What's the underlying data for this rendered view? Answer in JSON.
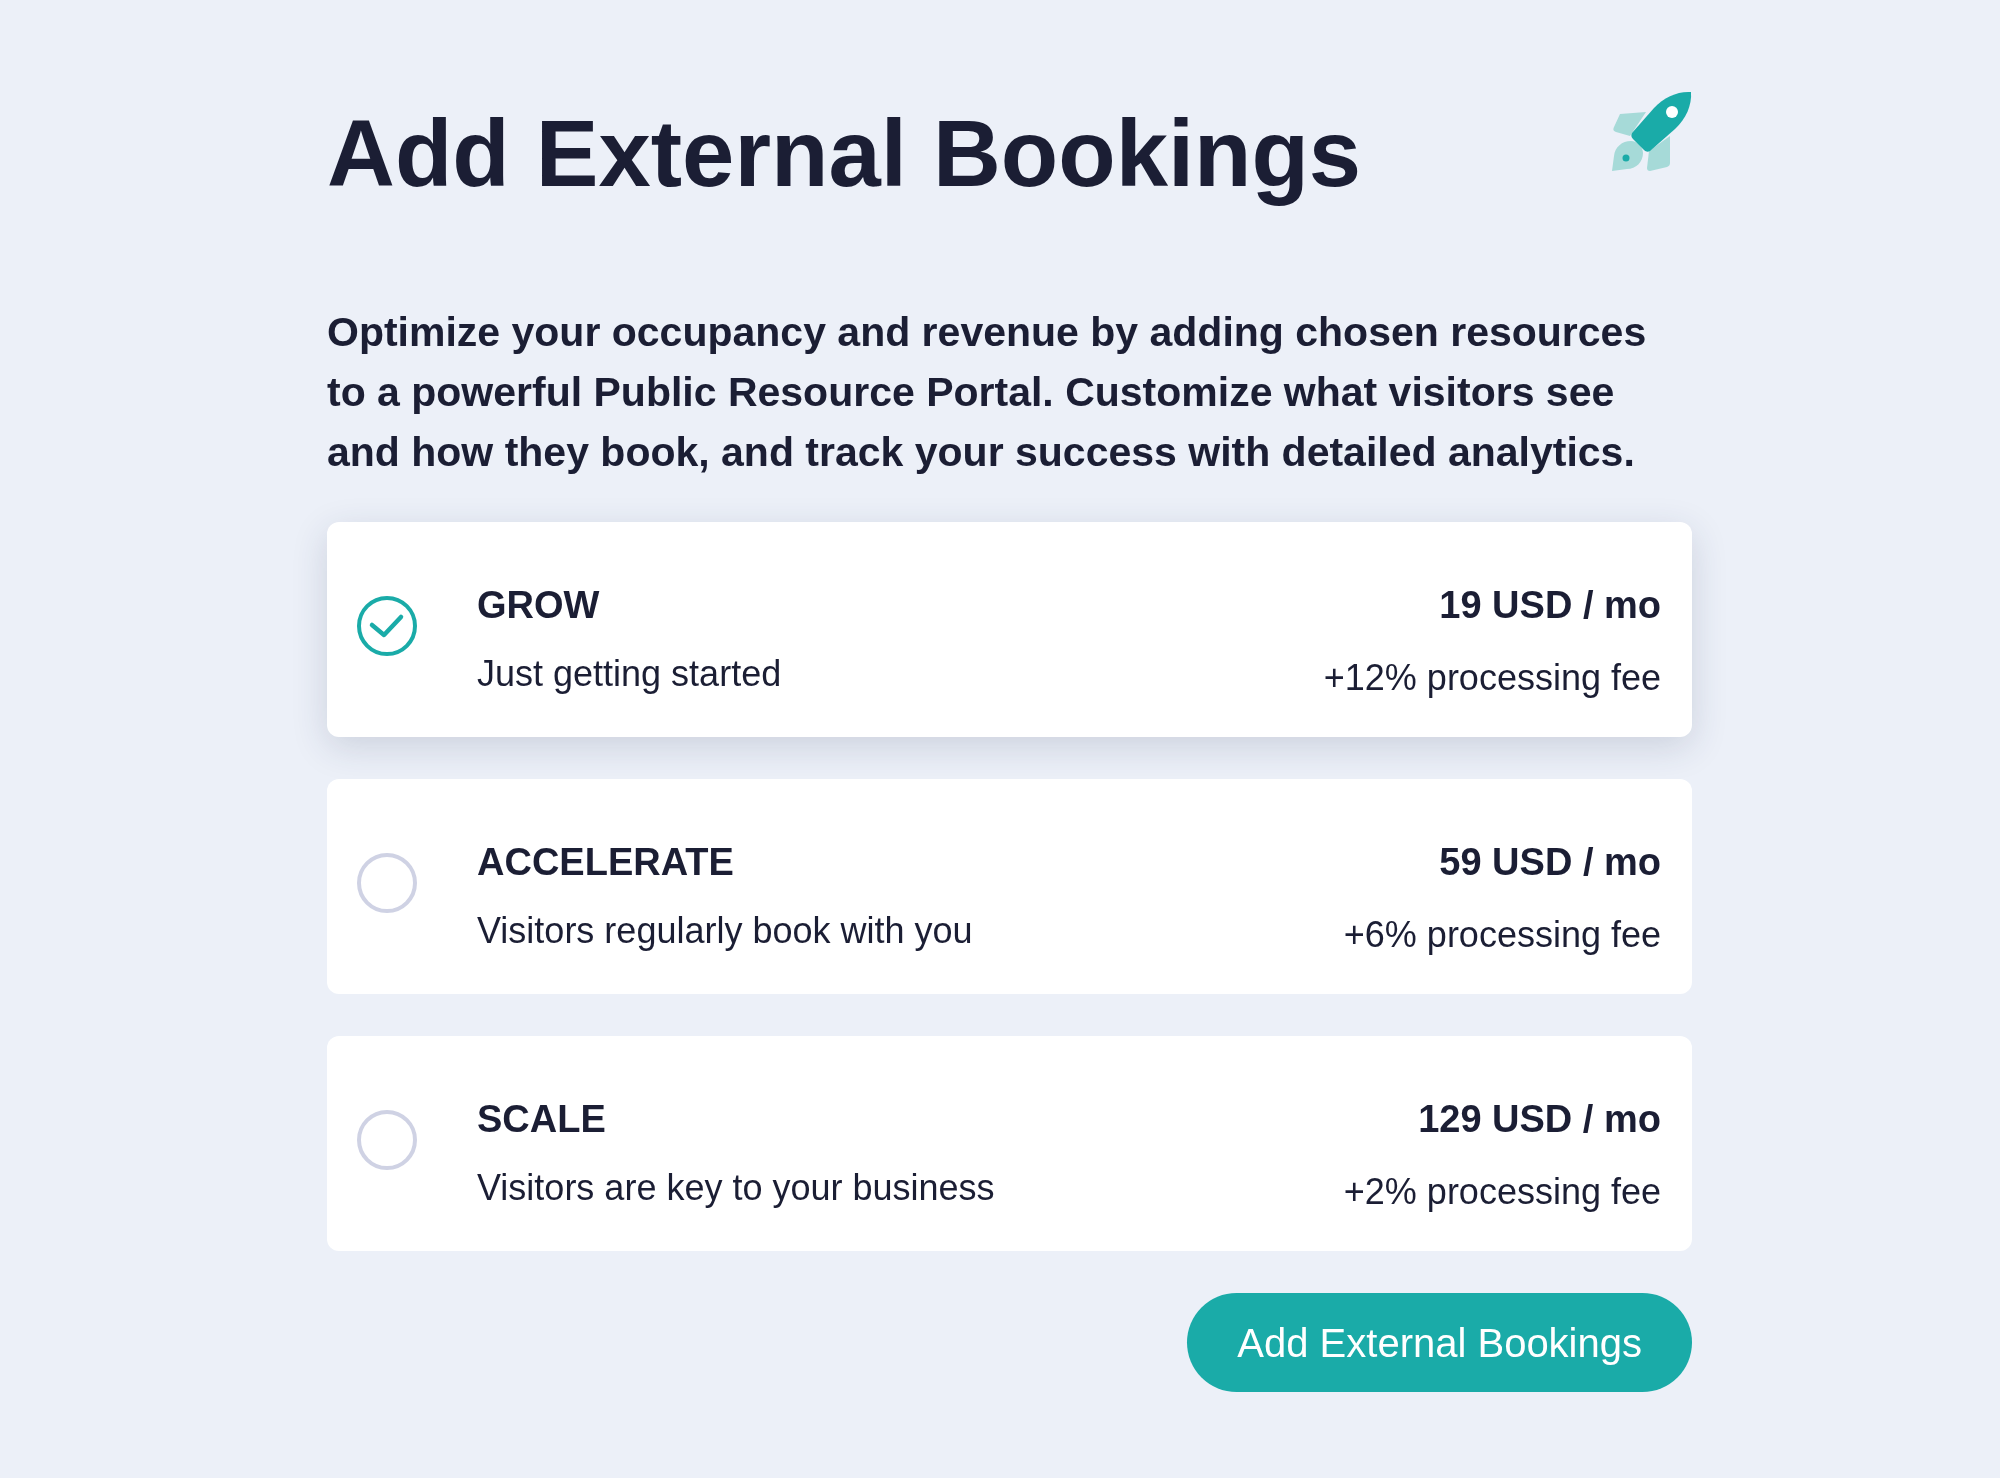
{
  "title": "Add External Bookings",
  "description": "Optimize your occupancy and revenue by adding chosen resources to a powerful Public Resource Portal. Customize what visitors see and how they book, and track your success with detailed analytics.",
  "plans": [
    {
      "name": "GROW",
      "tagline": "Just getting started",
      "price": "19 USD / mo",
      "fee": "+12% processing fee",
      "selected": true
    },
    {
      "name": "ACCELERATE",
      "tagline": "Visitors regularly book with you",
      "price": "59 USD / mo",
      "fee": "+6% processing fee",
      "selected": false
    },
    {
      "name": "SCALE",
      "tagline": "Visitors are key to your business",
      "price": "129 USD / mo",
      "fee": "+2% processing fee",
      "selected": false
    }
  ],
  "button": {
    "label": "Add External Bookings"
  }
}
